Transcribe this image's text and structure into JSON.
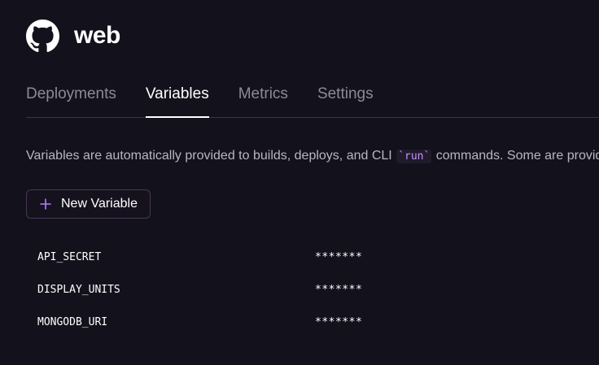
{
  "service": {
    "name": "web",
    "logo_icon": "github-icon"
  },
  "tabs": [
    {
      "label": "Deployments",
      "active": false
    },
    {
      "label": "Variables",
      "active": true
    },
    {
      "label": "Metrics",
      "active": false
    },
    {
      "label": "Settings",
      "active": false
    }
  ],
  "description": {
    "before": "Variables are automatically provided to builds, deploys, and CLI ",
    "code": "`run`",
    "after": " commands. Some are provided by plugins"
  },
  "new_variable_button": {
    "label": "New Variable",
    "icon": "plus-icon"
  },
  "variables": [
    {
      "name": "API_SECRET",
      "value": "*******"
    },
    {
      "name": "DISPLAY_UNITS",
      "value": "*******"
    },
    {
      "name": "MONGODB_URI",
      "value": "*******"
    }
  ],
  "colors": {
    "background": "#13111c",
    "accent": "#c792ff",
    "muted_text": "#8d8a98"
  }
}
